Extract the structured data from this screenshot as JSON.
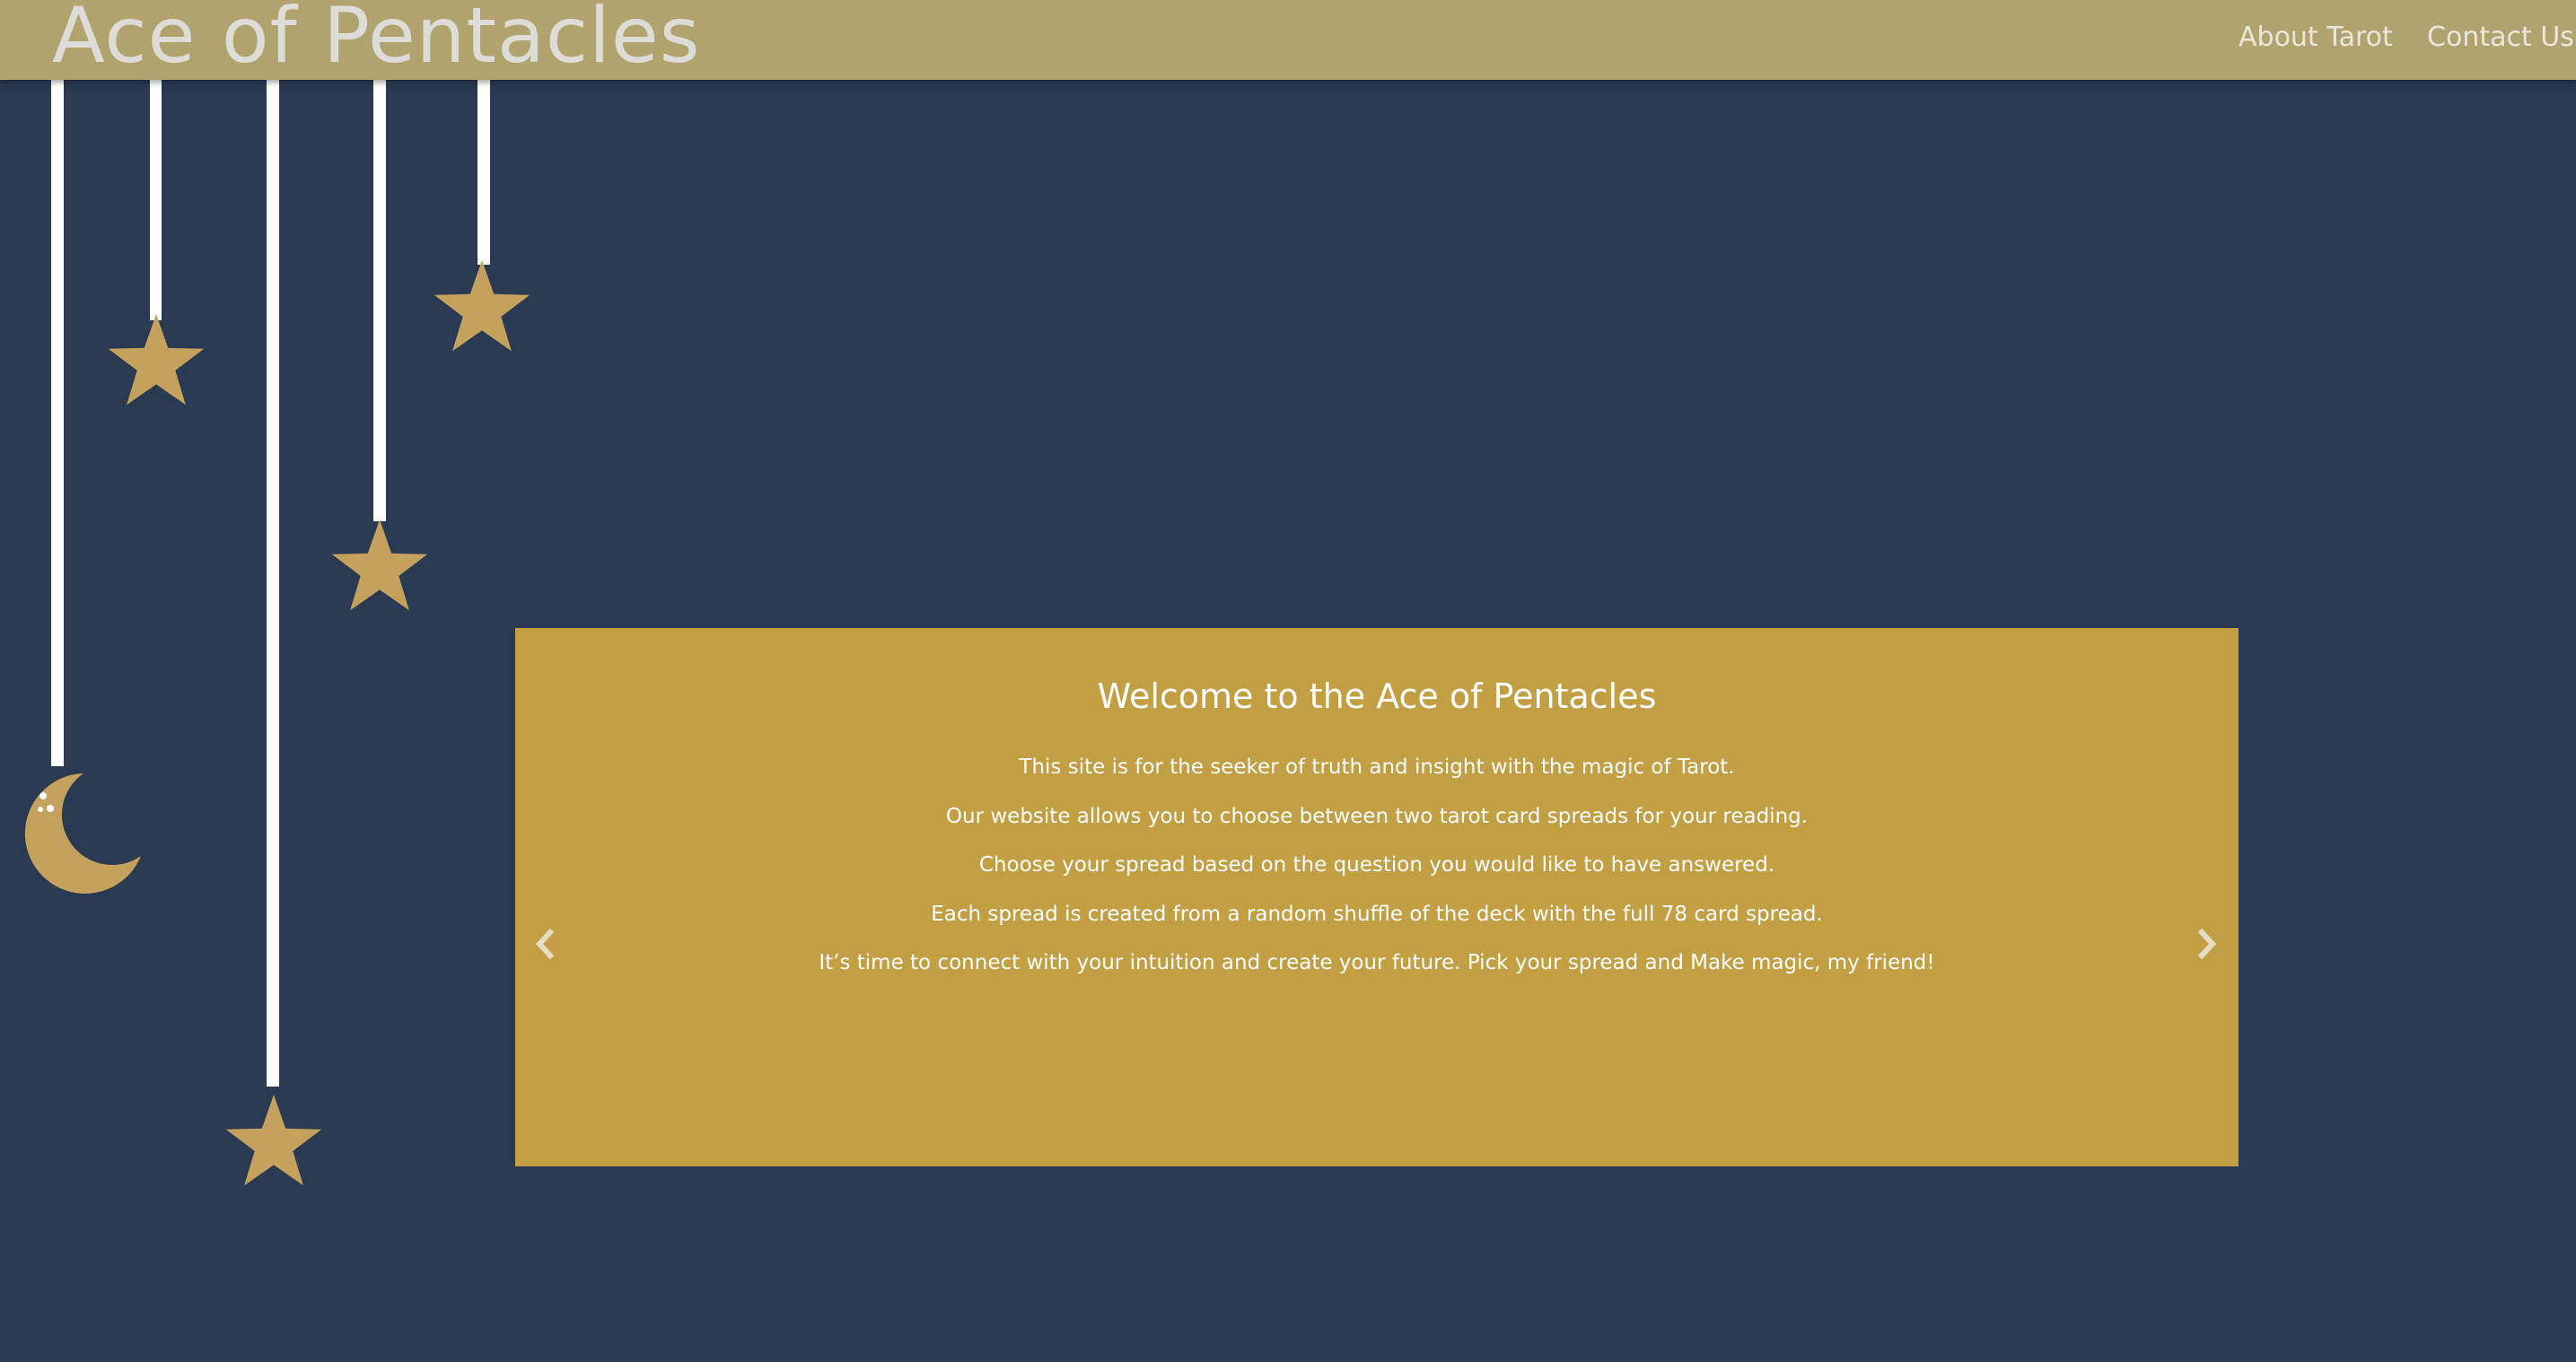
{
  "navbar": {
    "brand": "Ace of Pentacles",
    "links": [
      {
        "label": "About Tarot"
      },
      {
        "label": "Contact Us"
      }
    ]
  },
  "carousel": {
    "title": "Welcome to the Ace of Pentacles",
    "lines": [
      "This site is for the seeker of truth and insight with the magic of Tarot.",
      "Our website allows you to choose between two tarot card spreads for your reading.",
      "Choose your spread based on the question you would like to have answered.",
      "Each spread is created from a random shuffle of the deck with the full 78 card spread.",
      "It’s time to connect with your intuition and create your future. Pick your spread and Make magic, my friend!"
    ],
    "prev_icon": "chevron-left-icon",
    "next_icon": "chevron-right-icon"
  },
  "decorations": {
    "hanging_items": [
      "moon-icon",
      "star-icon",
      "star-icon",
      "star-icon",
      "star-icon"
    ]
  },
  "colors": {
    "background": "#2a3a52",
    "navbar": "#b0a36e",
    "carousel": "#c19f42",
    "ornament": "#c4a15c",
    "string": "#ffffff"
  }
}
